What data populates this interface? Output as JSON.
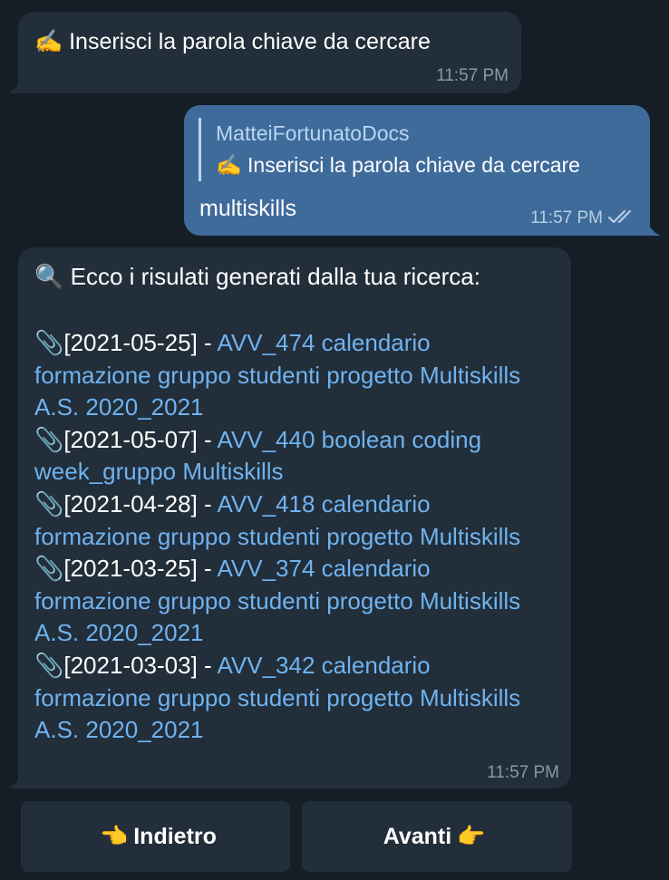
{
  "messages": {
    "prompt": {
      "icon": "writing-hand",
      "icon_glyph": "✍️",
      "text": "Inserisci la parola chiave da cercare",
      "time": "11:57 PM"
    },
    "user_reply": {
      "reply_to_name": "MatteiFortunatoDocs",
      "reply_to_icon_glyph": "✍️",
      "reply_to_text": "Inserisci la parola chiave da cercare",
      "text": "multiskills",
      "time": "11:57 PM",
      "status": "read"
    },
    "results": {
      "header_icon": "magnifying-glass",
      "header_icon_glyph": "🔍",
      "header_text": "Ecco i risulati generati dalla tua ricerca:",
      "time": "11:57 PM",
      "items": [
        {
          "icon_glyph": "📎",
          "date": "[2021-05-25] - ",
          "title": "AVV_474 calendario formazione gruppo studenti  progetto Multiskills A.S. 2020_2021"
        },
        {
          "icon_glyph": "📎",
          "date": "[2021-05-07] - ",
          "title": "AVV_440 boolean coding week_gruppo Multiskills"
        },
        {
          "icon_glyph": "📎",
          "date": "[2021-04-28] - ",
          "title": "AVV_418 calendario formazione gruppo studenti  progetto Multiskills"
        },
        {
          "icon_glyph": "📎",
          "date": "[2021-03-25] - ",
          "title": "AVV_374 calendario formazione gruppo studenti  progetto Multiskills A.S. 2020_2021"
        },
        {
          "icon_glyph": "📎",
          "date": "[2021-03-03] - ",
          "title": "AVV_342 calendario formazione gruppo studenti  progetto Multiskills A.S. 2020_2021"
        }
      ]
    }
  },
  "keyboard": {
    "back": {
      "icon_glyph": "👈",
      "label": "Indietro"
    },
    "next": {
      "icon_glyph": "👉",
      "label": "Avanti"
    }
  },
  "colors": {
    "background": "#151d27",
    "incoming_bubble": "#222e3a",
    "outgoing_bubble": "#3f6b9b",
    "link": "#6fb3f0",
    "timestamp": "#8a98a6"
  }
}
